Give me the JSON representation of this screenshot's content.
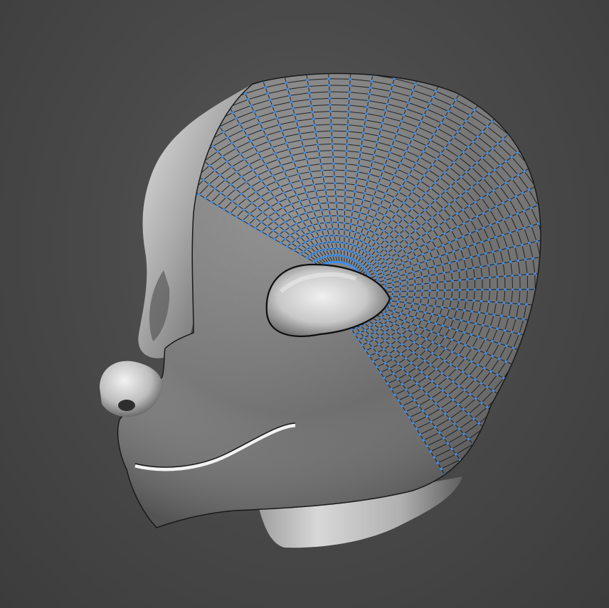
{
  "scene": {
    "subject": "retopology-head-mesh",
    "colors": {
      "background_center": "#5a5a5a",
      "background_edge": "#3c3c3c",
      "sculpt_light": "#dcdcdc",
      "sculpt_mid": "#9a9a9a",
      "sculpt_dark": "#4c4c4c",
      "topology_face": "#7c7c7c",
      "topology_edge": "#141414",
      "vertex": "#3a8ef0"
    }
  }
}
